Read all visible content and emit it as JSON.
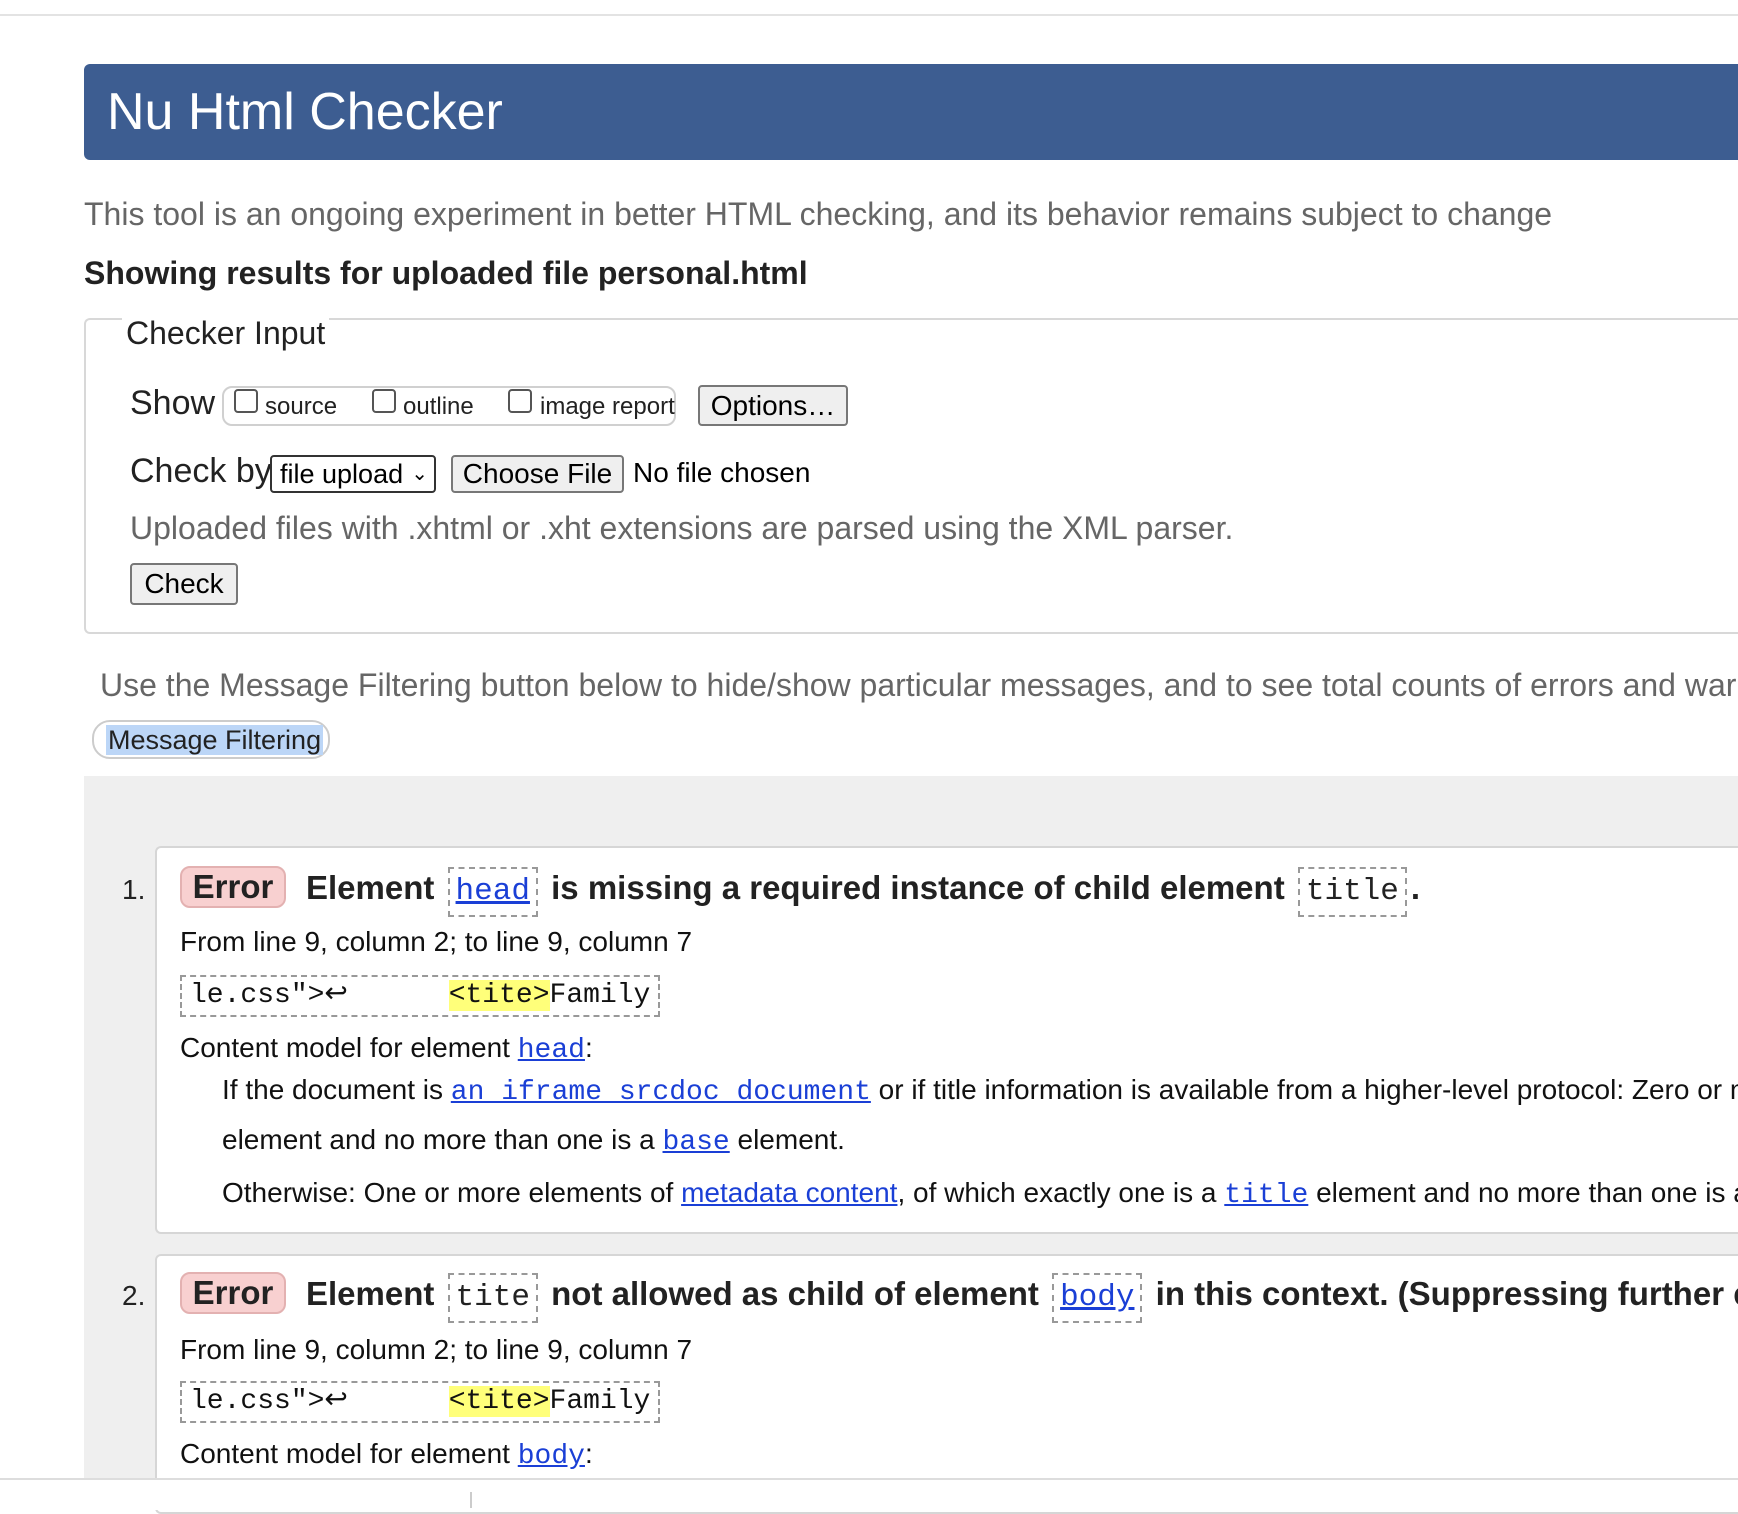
{
  "header": {
    "title": "Nu Html Checker"
  },
  "intro": "This tool is an ongoing experiment in better HTML checking, and its behavior remains subject to change",
  "results_title": "Showing results for uploaded file personal.html",
  "checker_input": {
    "legend": "Checker Input",
    "show_label": "Show",
    "show_options": {
      "source": "source",
      "outline": "outline",
      "image_report": "image report"
    },
    "options_button": "Options…",
    "check_by_label": "Check by",
    "check_by_selected": "file upload",
    "choose_file_button": "Choose File",
    "no_file_text": "No file chosen",
    "parser_note": "Uploaded files with .xhtml or .xht extensions are parsed using the XML parser.",
    "check_button": "Check"
  },
  "filter": {
    "note": "Use the Message Filtering button below to hide/show particular messages, and to see total counts of errors and war",
    "button": "Message Filtering"
  },
  "messages": [
    {
      "number": "1.",
      "type": "Error",
      "title_prefix": "Element",
      "title_code1": "head",
      "title_mid": "is missing a required instance of child element",
      "title_code2": "title",
      "title_end": ".",
      "location": "From line 9, column 2; to line 9, column 7",
      "extract_pre": "le.css\">↩      ",
      "extract_hl": "<tite>",
      "extract_post": "Family",
      "content_model_prefix": "Content model for element",
      "content_model_el": "head",
      "content_model_colon": ":",
      "line1_a": "If the document is",
      "line1_link": "an iframe srcdoc document",
      "line1_b": "or if title information is available from a higher-level protocol: Zero or mor",
      "line2_a": "element and no more than one is a",
      "line2_link": "base",
      "line2_b": "element.",
      "line3_a": "Otherwise: One or more elements of",
      "line3_link1": "metadata content",
      "line3_b": ", of which exactly one is a",
      "line3_link2": "title",
      "line3_c": "element and no more than one is a"
    },
    {
      "number": "2.",
      "type": "Error",
      "title_prefix": "Element",
      "title_code1": "tite",
      "title_mid": "not allowed as child of element",
      "title_code2": "body",
      "title_end": "in this context. (Suppressing further erro",
      "location": "From line 9, column 2; to line 9, column 7",
      "extract_pre": "le.css\">↩      ",
      "extract_hl": "<tite>",
      "extract_post": "Family",
      "content_model_prefix": "Content model for element",
      "content_model_el": "body",
      "content_model_colon": ":"
    }
  ],
  "colors": {
    "header_bg": "#3d5d91",
    "error_badge_bg": "#f8d0d0",
    "link": "#1a3fd6",
    "highlight": "#ffff7a"
  }
}
